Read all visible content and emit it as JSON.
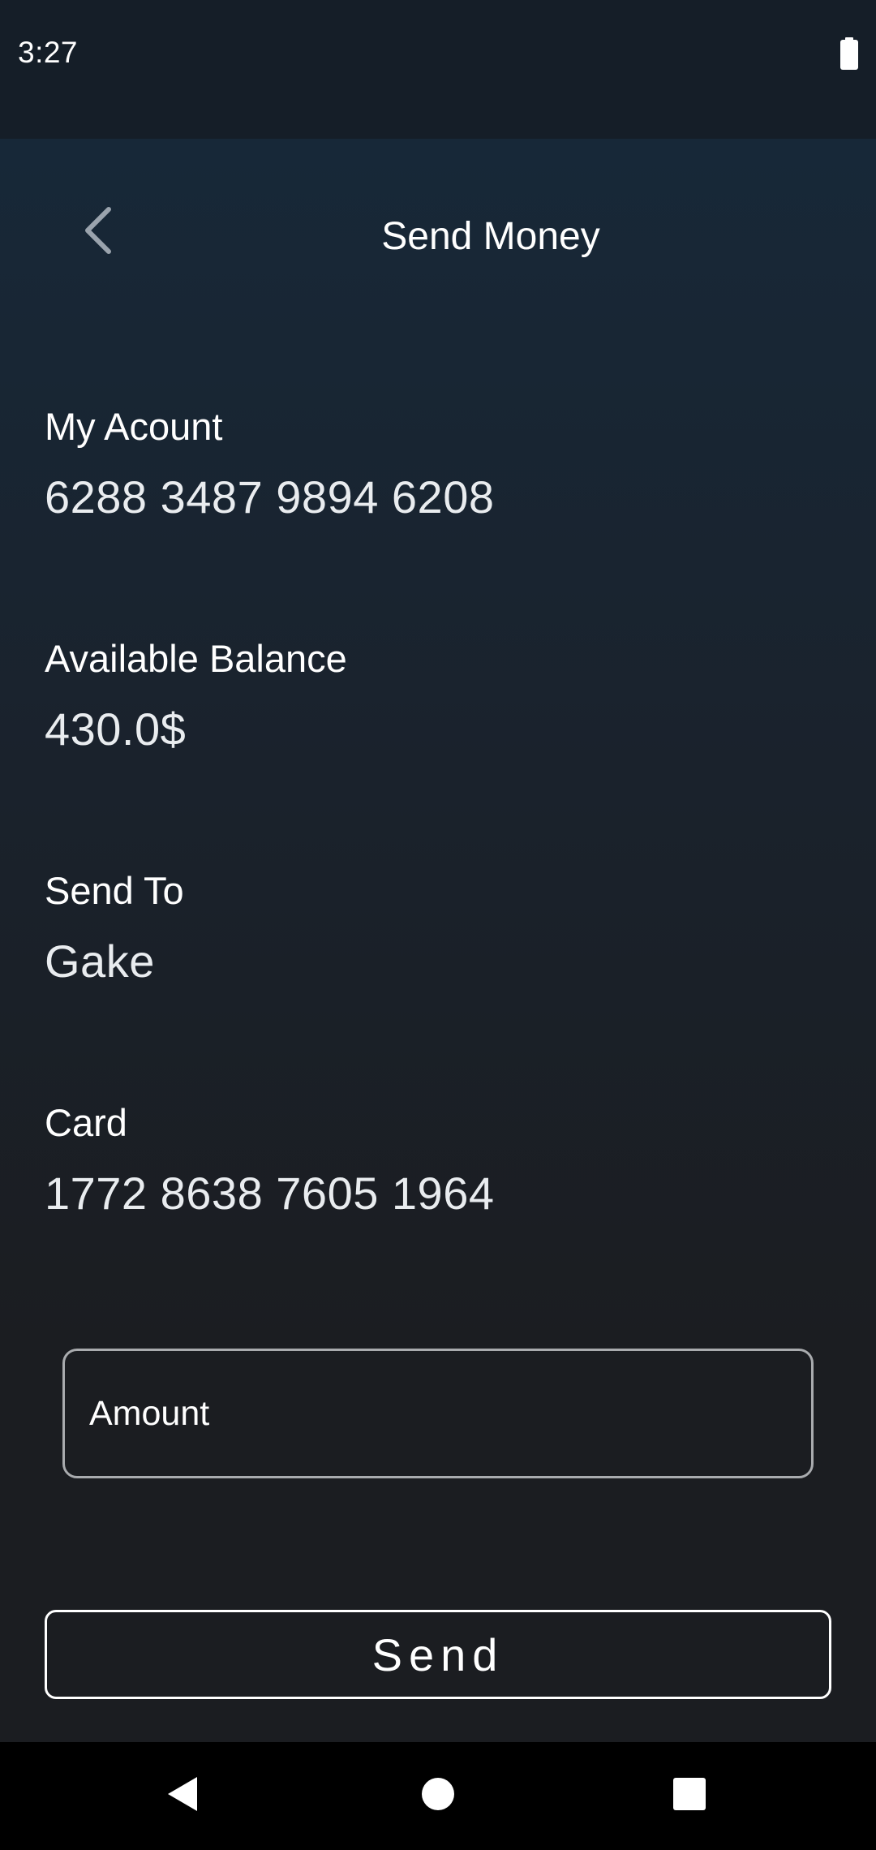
{
  "status_bar": {
    "time": "3:27",
    "battery_icon": "battery-full-icon"
  },
  "app_bar": {
    "title": "Send Money",
    "back_icon": "chevron-left-icon"
  },
  "account": {
    "label": "My Acount",
    "value": "6288 3487 9894 6208"
  },
  "balance": {
    "label": "Available Balance",
    "value": "430.0$"
  },
  "recipient": {
    "label": "Send To",
    "value": "Gake"
  },
  "card": {
    "label": "Card",
    "value": "1772 8638 7605 1964"
  },
  "amount": {
    "placeholder": "Amount",
    "value": ""
  },
  "send_button": {
    "label": "Send"
  },
  "nav_bar": {
    "back_icon": "triangle-back-icon",
    "home_icon": "circle-home-icon",
    "recents_icon": "square-recents-icon"
  },
  "colors": {
    "status_bar_bg": "#151e28",
    "content_top": "#172838",
    "content_bottom": "#1b1d21",
    "nav_bar_bg": "#000000",
    "text": "#ffffff"
  }
}
